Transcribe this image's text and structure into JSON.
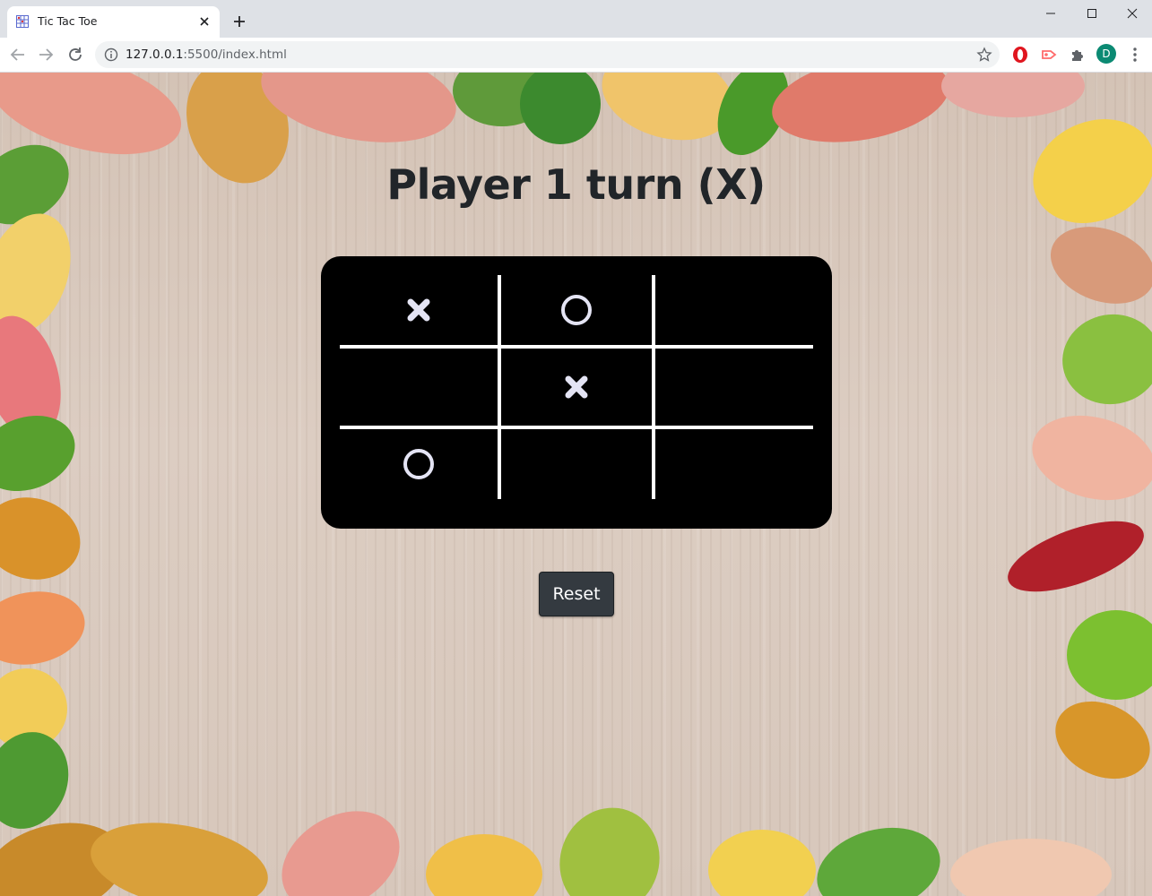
{
  "browser": {
    "tab_title": "Tic Tac Toe",
    "url_host": "127.0.0.1",
    "url_rest": ":5500/index.html",
    "profile_initial": "D"
  },
  "game": {
    "status": "Player 1 turn (X)",
    "reset_label": "Reset",
    "board": [
      [
        "X",
        "O",
        ""
      ],
      [
        "",
        "X",
        ""
      ],
      [
        "O",
        "",
        ""
      ]
    ],
    "colors": {
      "board_bg": "#000000",
      "grid_lines": "#ffffff",
      "mark": "#e4e4f4",
      "heading": "#212529",
      "button_bg": "#343a40"
    }
  }
}
